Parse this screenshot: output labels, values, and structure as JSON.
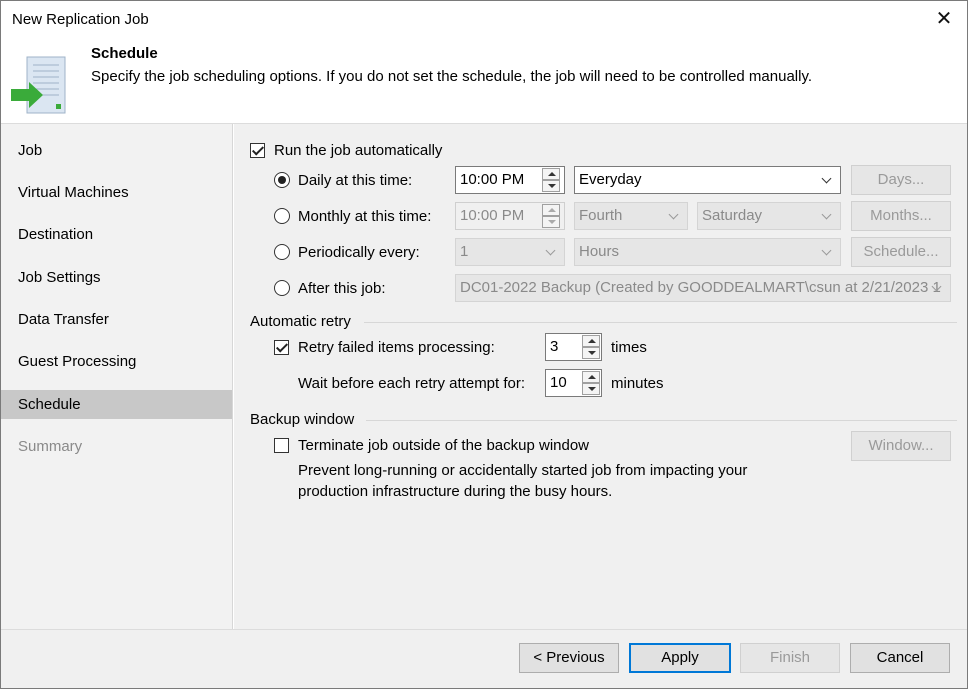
{
  "window": {
    "title": "New Replication Job",
    "close_glyph": "✕"
  },
  "header": {
    "title": "Schedule",
    "description": "Specify the job scheduling options. If you do not set the schedule, the job will need to be controlled manually.",
    "icon": "schedule-document-icon"
  },
  "sidebar": {
    "items": [
      {
        "label": "Job",
        "state": "normal"
      },
      {
        "label": "Virtual Machines",
        "state": "normal"
      },
      {
        "label": "Destination",
        "state": "normal"
      },
      {
        "label": "Job Settings",
        "state": "normal"
      },
      {
        "label": "Data Transfer",
        "state": "normal"
      },
      {
        "label": "Guest Processing",
        "state": "normal"
      },
      {
        "label": "Schedule",
        "state": "active"
      },
      {
        "label": "Summary",
        "state": "disabled"
      }
    ]
  },
  "schedule": {
    "run_auto": {
      "label": "Run the job automatically",
      "checked": true
    },
    "daily": {
      "label": "Daily at this time:",
      "time": "10:00 PM",
      "frequency": "Everyday",
      "button": "Days...",
      "selected": true
    },
    "monthly": {
      "label": "Monthly at this time:",
      "time": "10:00 PM",
      "week": "Fourth",
      "day": "Saturday",
      "button": "Months...",
      "selected": false
    },
    "periodically": {
      "label": "Periodically every:",
      "value": "1",
      "unit": "Hours",
      "button": "Schedule...",
      "selected": false
    },
    "after": {
      "label": "After this job:",
      "job": "DC01-2022 Backup (Created by GOODDEALMART\\csun at 2/21/2023 1",
      "selected": false
    }
  },
  "retry": {
    "group_label": "Automatic retry",
    "failed": {
      "label": "Retry failed items processing:",
      "value": "3",
      "unit": "times",
      "checked": true
    },
    "wait": {
      "label": "Wait before each retry attempt for:",
      "value": "10",
      "unit": "minutes"
    }
  },
  "backup_window": {
    "group_label": "Backup window",
    "terminate": {
      "label": "Terminate job outside of the backup window",
      "checked": false
    },
    "button": "Window...",
    "note_line1": "Prevent long-running or accidentally started job from impacting your",
    "note_line2": "production infrastructure during the busy hours."
  },
  "footer": {
    "previous": "< Previous",
    "apply": "Apply",
    "finish": "Finish",
    "cancel": "Cancel"
  },
  "colors": {
    "accent": "#0078d7",
    "sidebar_active": "#c8c8c8",
    "arrow_green": "#3aab3a"
  }
}
